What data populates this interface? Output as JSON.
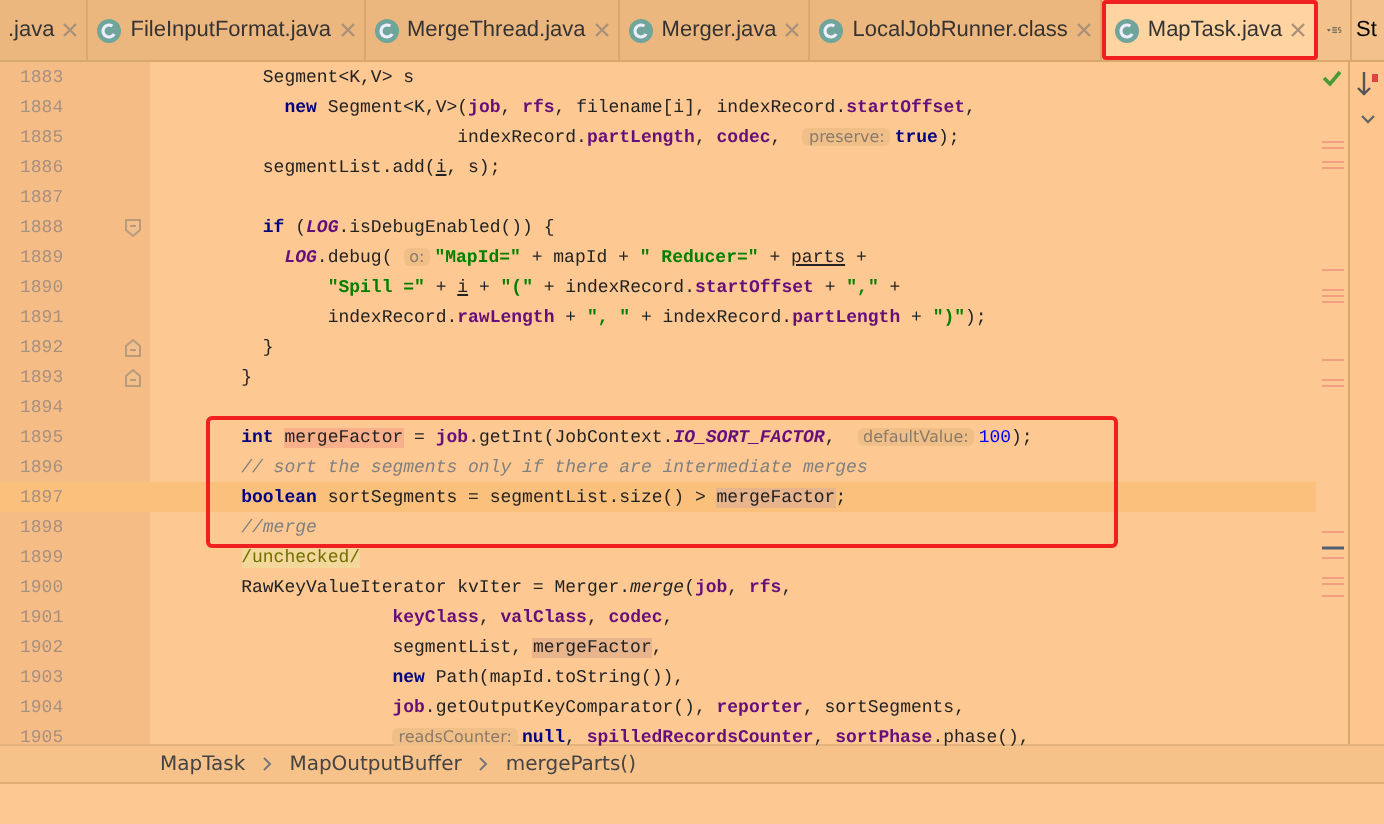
{
  "tabs": [
    {
      "label": ".java",
      "icon": false,
      "selected": false,
      "outlined": false
    },
    {
      "label": "FileInputFormat.java",
      "icon": true,
      "selected": false,
      "outlined": false
    },
    {
      "label": "MergeThread.java",
      "icon": true,
      "selected": false,
      "outlined": false
    },
    {
      "label": "Merger.java",
      "icon": true,
      "selected": false,
      "outlined": false
    },
    {
      "label": "LocalJobRunner.class",
      "icon": true,
      "selected": false,
      "outlined": false
    },
    {
      "label": "MapTask.java",
      "icon": true,
      "selected": true,
      "outlined": true
    }
  ],
  "side_panel": {
    "label": "St"
  },
  "lines": [
    {
      "number": "1883",
      "tokens": [
        {
          "text": "      Segment<K,V> s",
          "kind": "plain"
        }
      ]
    },
    {
      "number": "1884",
      "tokens": [
        {
          "text": "        new",
          "kind": "keyword"
        },
        {
          "text": " Segment<K,V>(",
          "kind": "plain"
        },
        {
          "text": "job",
          "kind": "field"
        },
        {
          "text": ", ",
          "kind": "plain"
        },
        {
          "text": "rfs",
          "kind": "field"
        },
        {
          "text": ", filename[i], indexRecord.",
          "kind": "plain"
        },
        {
          "text": "startOffset",
          "kind": "field"
        },
        {
          "text": ",",
          "kind": "plain"
        }
      ]
    },
    {
      "number": "1885",
      "tokens": [
        {
          "text": "                        indexRecord.",
          "kind": "plain"
        },
        {
          "text": "partLength",
          "kind": "field"
        },
        {
          "text": ", ",
          "kind": "plain"
        },
        {
          "text": "codec",
          "kind": "field"
        },
        {
          "text": ",  ",
          "kind": "plain"
        },
        {
          "text": "preserve:",
          "kind": "hint"
        },
        {
          "text": "true",
          "kind": "keyword"
        },
        {
          "text": ");",
          "kind": "plain"
        }
      ]
    },
    {
      "number": "1886",
      "tokens": [
        {
          "text": "      segmentList.add(",
          "kind": "plain"
        },
        {
          "text": "i",
          "kind": "underlined"
        },
        {
          "text": ", s);",
          "kind": "plain"
        }
      ]
    },
    {
      "number": "1887"
    },
    {
      "number": "1888",
      "fold_start": true,
      "tokens": [
        {
          "text": "      if",
          "kind": "keyword"
        },
        {
          "text": " (",
          "kind": "plain"
        },
        {
          "text": "LOG",
          "kind": "static"
        },
        {
          "text": ".isDebugEnabled()) {",
          "kind": "plain"
        }
      ]
    },
    {
      "number": "1889",
      "tokens": [
        {
          "text": "        LOG",
          "kind": "static"
        },
        {
          "text": ".debug( ",
          "kind": "plain"
        },
        {
          "text": "o:",
          "kind": "hint"
        },
        {
          "text": "\"MapId=\"",
          "kind": "string"
        },
        {
          "text": " + mapId + ",
          "kind": "plain"
        },
        {
          "text": "\" Reducer=\"",
          "kind": "string"
        },
        {
          "text": " + ",
          "kind": "plain"
        },
        {
          "text": "parts",
          "kind": "underlined"
        },
        {
          "text": " +",
          "kind": "plain"
        }
      ]
    },
    {
      "number": "1890",
      "tokens": [
        {
          "text": "            \"Spill =\"",
          "kind": "string"
        },
        {
          "text": " + ",
          "kind": "plain"
        },
        {
          "text": "i",
          "kind": "underlined"
        },
        {
          "text": " + ",
          "kind": "plain"
        },
        {
          "text": "\"(\"",
          "kind": "string"
        },
        {
          "text": " + indexRecord.",
          "kind": "plain"
        },
        {
          "text": "startOffset",
          "kind": "field"
        },
        {
          "text": " + ",
          "kind": "plain"
        },
        {
          "text": "\",\"",
          "kind": "string"
        },
        {
          "text": " +",
          "kind": "plain"
        }
      ]
    },
    {
      "number": "1891",
      "tokens": [
        {
          "text": "            indexRecord.",
          "kind": "plain"
        },
        {
          "text": "rawLength",
          "kind": "field"
        },
        {
          "text": " + ",
          "kind": "plain"
        },
        {
          "text": "\", \"",
          "kind": "string"
        },
        {
          "text": " + indexRecord.",
          "kind": "plain"
        },
        {
          "text": "partLength",
          "kind": "field"
        },
        {
          "text": " + ",
          "kind": "plain"
        },
        {
          "text": "\")\"",
          "kind": "string"
        },
        {
          "text": ");",
          "kind": "plain"
        }
      ]
    },
    {
      "number": "1892",
      "fold_end": true,
      "tokens": [
        {
          "text": "      }",
          "kind": "plain"
        }
      ]
    },
    {
      "number": "1893",
      "fold_end": true,
      "tokens": [
        {
          "text": "    }",
          "kind": "plain"
        }
      ]
    },
    {
      "number": "1894"
    },
    {
      "number": "1895",
      "boxed": true,
      "tokens": [
        {
          "text": "    int ",
          "kind": "keyword"
        },
        {
          "text": "mergeFactor",
          "kind": "usage_write"
        },
        {
          "text": " = ",
          "kind": "plain"
        },
        {
          "text": "job",
          "kind": "field"
        },
        {
          "text": ".getInt(JobContext.",
          "kind": "plain"
        },
        {
          "text": "IO_SORT_FACTOR",
          "kind": "static"
        },
        {
          "text": ",  ",
          "kind": "plain"
        },
        {
          "text": "defaultValue:",
          "kind": "hint"
        },
        {
          "text": "100",
          "kind": "number"
        },
        {
          "text": ");",
          "kind": "plain"
        }
      ]
    },
    {
      "number": "1896",
      "boxed": true,
      "tokens": [
        {
          "text": "    // sort the segments only if there are intermediate merges",
          "kind": "comment"
        }
      ]
    },
    {
      "number": "1897",
      "boxed": true,
      "current": true,
      "tokens": [
        {
          "text": "    boolean",
          "kind": "keyword"
        },
        {
          "text": " sortSegments = segmentList.size() > ",
          "kind": "plain"
        },
        {
          "text": "mergeFactor",
          "kind": "usage_read"
        },
        {
          "text": ";",
          "kind": "plain"
        }
      ]
    },
    {
      "number": "1898",
      "boxed": true,
      "tokens": [
        {
          "text": "    //merge",
          "kind": "comment"
        }
      ]
    },
    {
      "number": "1899",
      "tokens": [
        {
          "text": "    /unchecked/",
          "kind": "annotation"
        }
      ]
    },
    {
      "number": "1900",
      "tokens": [
        {
          "text": "    RawKeyValueIterator kvIter = Merger.",
          "kind": "plain"
        },
        {
          "text": "merge",
          "kind": "method"
        },
        {
          "text": "(",
          "kind": "plain"
        },
        {
          "text": "job",
          "kind": "field"
        },
        {
          "text": ", ",
          "kind": "plain"
        },
        {
          "text": "rfs",
          "kind": "field"
        },
        {
          "text": ",",
          "kind": "plain"
        }
      ]
    },
    {
      "number": "1901",
      "tokens": [
        {
          "text": "                  keyClass",
          "kind": "field"
        },
        {
          "text": ", ",
          "kind": "plain"
        },
        {
          "text": "valClass",
          "kind": "field"
        },
        {
          "text": ", ",
          "kind": "plain"
        },
        {
          "text": "codec",
          "kind": "field"
        },
        {
          "text": ",",
          "kind": "plain"
        }
      ]
    },
    {
      "number": "1902",
      "tokens": [
        {
          "text": "                  segmentList, ",
          "kind": "plain"
        },
        {
          "text": "mergeFactor",
          "kind": "usage_read"
        },
        {
          "text": ",",
          "kind": "plain"
        }
      ]
    },
    {
      "number": "1903",
      "tokens": [
        {
          "text": "                  new",
          "kind": "keyword"
        },
        {
          "text": " Path(mapId.toString()),",
          "kind": "plain"
        }
      ]
    },
    {
      "number": "1904",
      "tokens": [
        {
          "text": "                  job",
          "kind": "field"
        },
        {
          "text": ".getOutputKeyComparator(), ",
          "kind": "plain"
        },
        {
          "text": "reporter",
          "kind": "field"
        },
        {
          "text": ", sortSegments,",
          "kind": "plain"
        }
      ]
    },
    {
      "number": "1905",
      "tokens": [
        {
          "text": "                  readsCounter:",
          "kind": "hint"
        },
        {
          "text": "null",
          "kind": "keyword"
        },
        {
          "text": ", ",
          "kind": "plain"
        },
        {
          "text": "spilledRecordsCounter",
          "kind": "field"
        },
        {
          "text": ", ",
          "kind": "plain"
        },
        {
          "text": "sortPhase",
          "kind": "field"
        },
        {
          "text": ".phase(),",
          "kind": "plain"
        }
      ]
    }
  ],
  "breadcrumb": [
    "MapTask",
    "MapOutputBuffer",
    "mergeParts()"
  ]
}
